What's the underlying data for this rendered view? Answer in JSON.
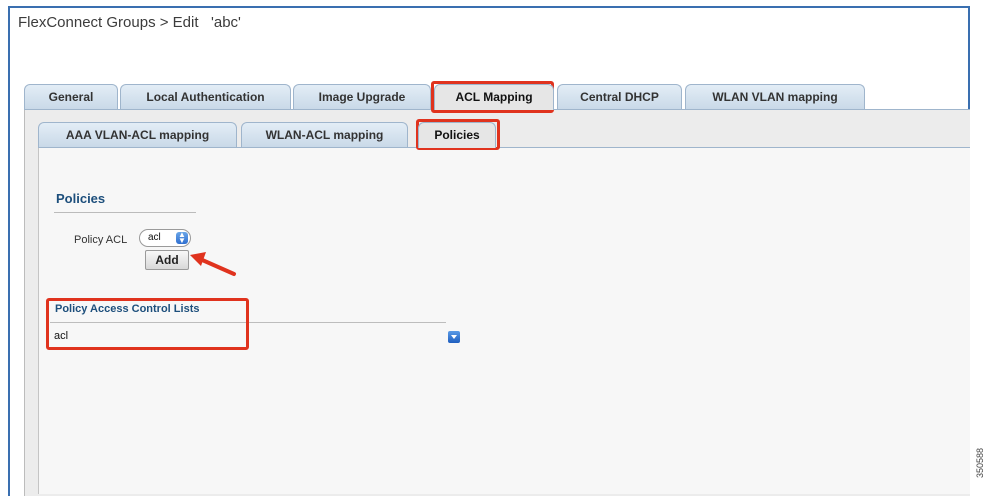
{
  "page": {
    "title": "FlexConnect Groups > Edit   'abc'"
  },
  "main_tabs": [
    {
      "label": "General"
    },
    {
      "label": "Local Authentication"
    },
    {
      "label": "Image Upgrade"
    },
    {
      "label": "ACL Mapping",
      "active": true
    },
    {
      "label": "Central DHCP"
    },
    {
      "label": "WLAN VLAN mapping"
    }
  ],
  "sub_tabs": [
    {
      "label": "AAA VLAN-ACL mapping"
    },
    {
      "label": "WLAN-ACL mapping"
    },
    {
      "label": "Policies",
      "active": true
    }
  ],
  "policies": {
    "heading": "Policies",
    "policy_acl_label": "Policy ACL",
    "policy_acl_value": "acl",
    "add_label": "Add"
  },
  "policy_list": {
    "heading": "Policy Access Control Lists",
    "items": [
      "acl"
    ]
  },
  "watermark": "350588",
  "colors": {
    "highlight": "#e0331e",
    "tab_blue": "#c9d9e8",
    "frame": "#3a6fb0"
  }
}
